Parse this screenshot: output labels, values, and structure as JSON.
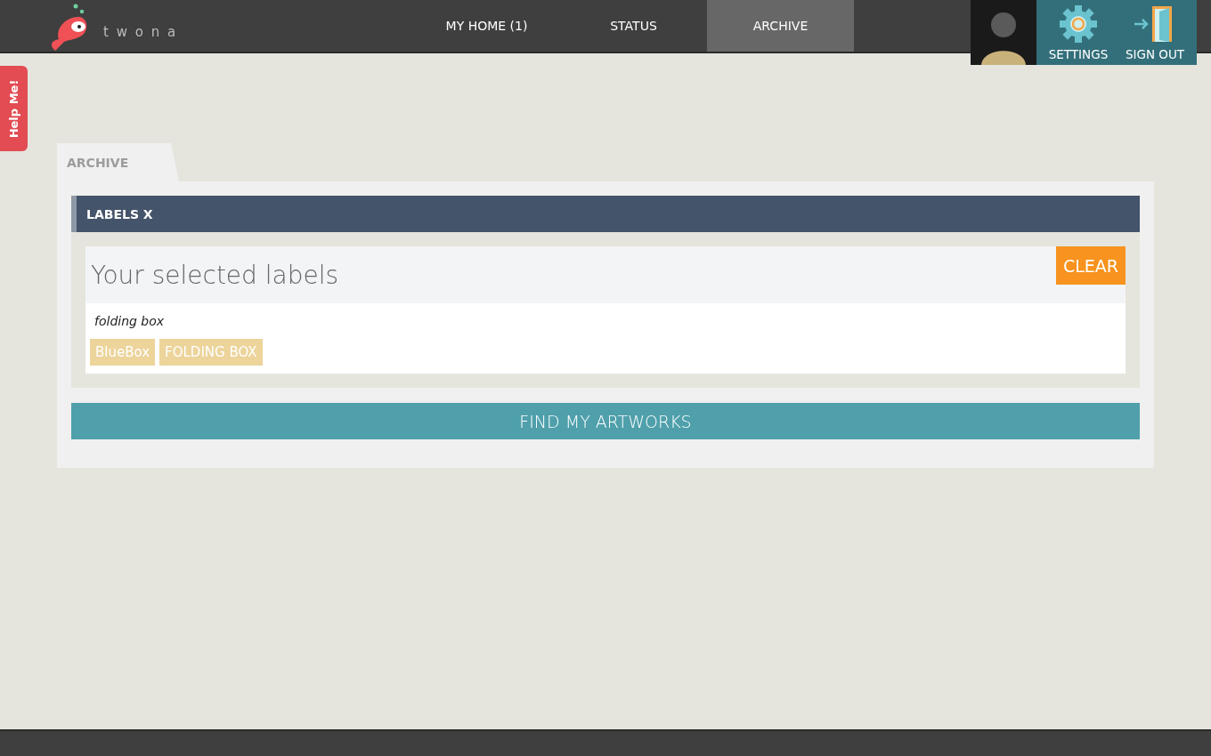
{
  "header": {
    "logo_text": "t w o n a",
    "nav": [
      {
        "label": "MY HOME (1)",
        "selected": false
      },
      {
        "label": "STATUS",
        "selected": false
      },
      {
        "label": "ARCHIVE",
        "selected": true
      }
    ],
    "actions": [
      {
        "kind": "settings",
        "label": "SETTINGS"
      },
      {
        "kind": "signout",
        "label": "SIGN OUT"
      }
    ]
  },
  "help_tab": "Help Me!",
  "page_tab": "ARCHIVE",
  "panel": {
    "title": "LABELS X",
    "selected_heading": "Your selected labels",
    "clear_button": "CLEAR",
    "search_value": "folding box",
    "labels": [
      "BlueBox",
      "FOLDING BOX"
    ],
    "find_button": "FIND MY ARTWORKS"
  }
}
